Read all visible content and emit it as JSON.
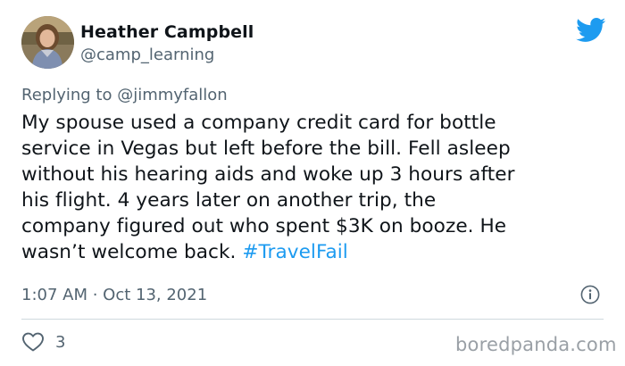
{
  "author": {
    "display_name": "Heather Campbell",
    "handle": "@camp_learning",
    "avatar_icon": "user-avatar-photo"
  },
  "reply": {
    "prefix": "Replying to ",
    "mention": "@jimmyfallon"
  },
  "tweet": {
    "text": "My spouse used a company credit card for bottle\nservice in Vegas but left before the bill. Fell asleep\nwithout his hearing aids and woke up 3 hours after\nhis flight. 4 years later on another trip, the\ncompany figured out who spent $3K on booze. He\nwasn’t welcome back. ",
    "hashtag": "#TravelFail"
  },
  "meta": {
    "timestamp": "1:07 AM · Oct 13, 2021"
  },
  "actions": {
    "like_count": "3"
  },
  "watermark": "boredpanda.com",
  "icons": {
    "brand": "twitter-bird-icon",
    "info": "info-icon",
    "like": "heart-icon"
  },
  "colors": {
    "brand_blue": "#1d9bf0",
    "text_primary": "#0f1419",
    "text_secondary": "#536471",
    "divider": "#cfd9de"
  }
}
